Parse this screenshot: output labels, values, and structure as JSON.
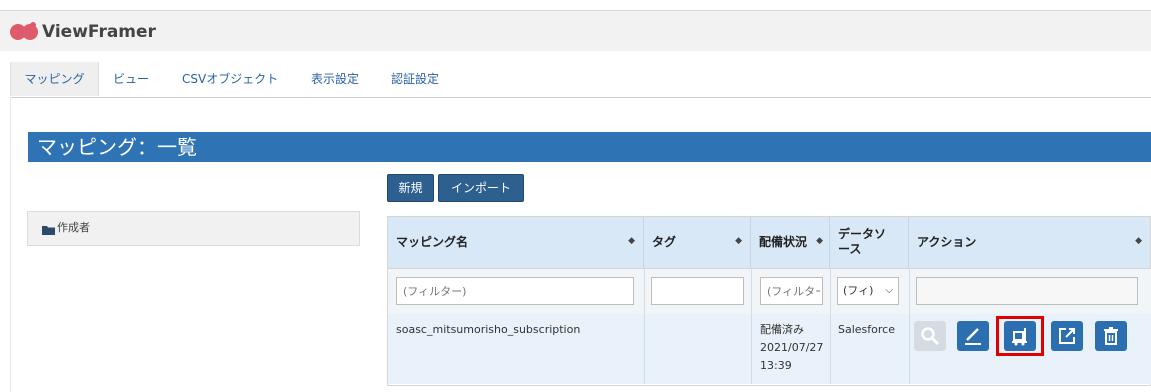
{
  "app": {
    "brand": "ViewFramer"
  },
  "tabs": [
    {
      "label": "マッピング",
      "active": true
    },
    {
      "label": "ビュー"
    },
    {
      "label": "CSVオブジェクト"
    },
    {
      "label": "表示設定"
    },
    {
      "label": "認証設定"
    }
  ],
  "page": {
    "title": "マッピング：一覧"
  },
  "toolbar": {
    "new_label": "新規",
    "import_label": "インポート"
  },
  "sidebar": {
    "author_label": "作成者"
  },
  "table": {
    "headers": [
      "マッピング名",
      "タグ",
      "配備状況",
      "データソース",
      "アクション"
    ],
    "filters": [
      {
        "placeholder": "(フィルター)"
      },
      {
        "placeholder": ""
      },
      {
        "placeholder": "(フィルター"
      },
      {
        "value": "(フィ)"
      },
      {
        "placeholder": ""
      }
    ],
    "rows": [
      {
        "name": "soasc_mitsumorisho_subscription",
        "tag": "",
        "status_line1": "配備済み",
        "status_line2": "2021/07/27",
        "status_line3": "13:39",
        "datasource": "Salesforce"
      }
    ],
    "actions": [
      "search-icon",
      "edit-icon",
      "deploy-icon",
      "export-icon",
      "delete-icon"
    ]
  },
  "colors": {
    "brand_logo": "#e05a6e",
    "title_bar": "#2e74b5",
    "button_dark": "#2d5f8f",
    "action_blue": "#2b6fb0",
    "highlight": "#e00000"
  }
}
